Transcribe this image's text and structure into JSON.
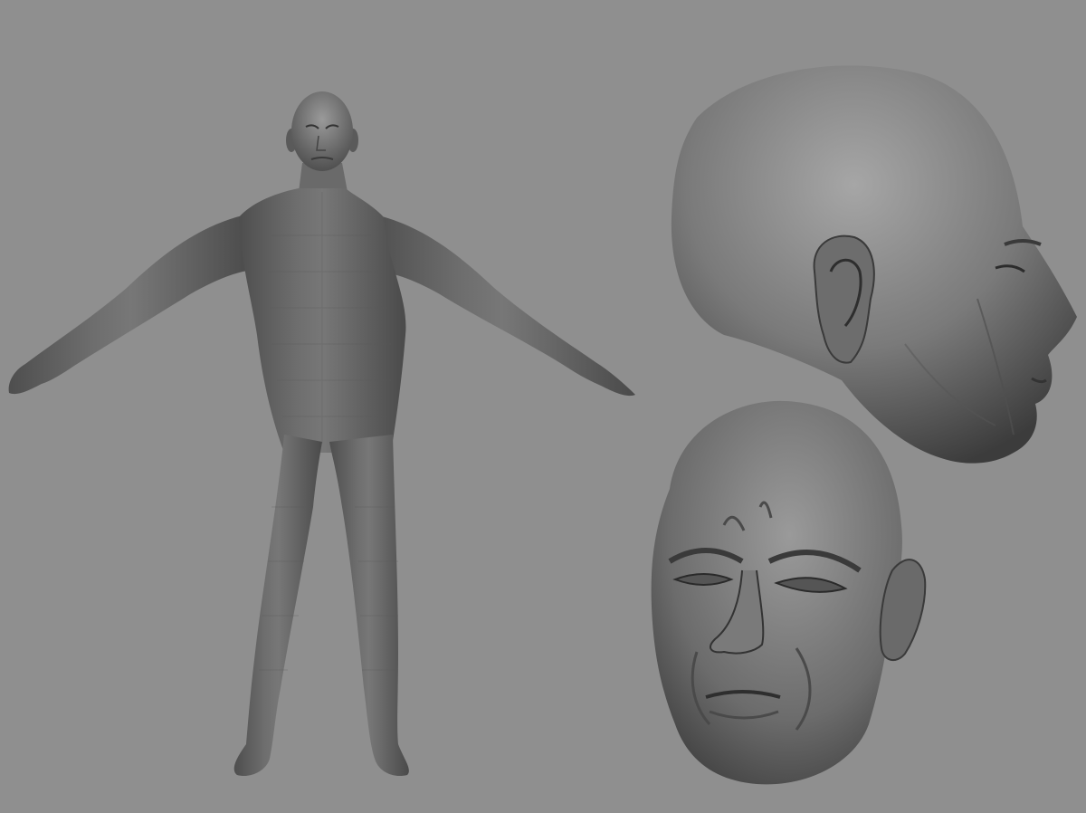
{
  "scene": {
    "background_color": "#8f8f8f",
    "model_color": "#6b6b6b",
    "highlight_color": "#a4a4a4",
    "shadow_color": "#3a3a3a",
    "views": [
      {
        "name": "full-body-front-t-pose"
      },
      {
        "name": "head-side-profile"
      },
      {
        "name": "head-three-quarter-front"
      }
    ]
  }
}
